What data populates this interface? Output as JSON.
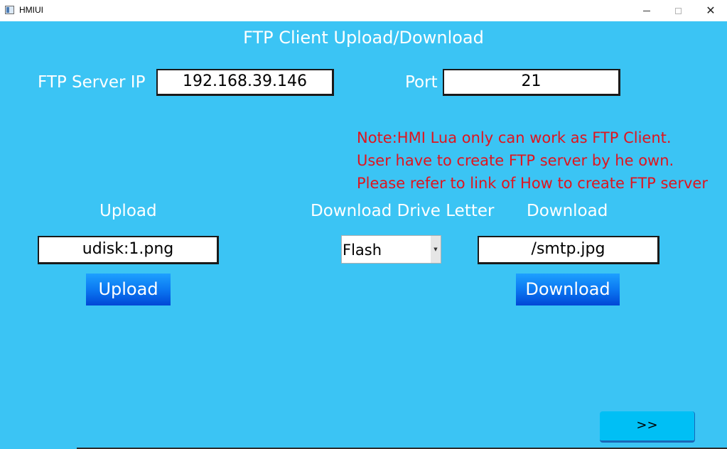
{
  "window": {
    "title": "HMIUI",
    "controls": {
      "minimize_icon": "minimize-icon",
      "maximize_icon": "maximize-icon",
      "close_icon": "close-icon"
    }
  },
  "screen": {
    "title": "FTP Client Upload/Download"
  },
  "server": {
    "ip_label": "FTP Server IP",
    "ip_value": "192.168.39.146",
    "port_label": "Port",
    "port_value": "21"
  },
  "note": {
    "line1": "Note:HMI Lua only can work as FTP Client.",
    "line2": "User have to create FTP server by he own.",
    "line3": "Please refer to link of How to create FTP server",
    "color": "#e0141e"
  },
  "upload": {
    "label": "Upload",
    "file_value": "udisk:1.png",
    "button_label": "Upload"
  },
  "download": {
    "drive_label": "Download Drive Letter",
    "drive_selected": "Flash",
    "label": "Download",
    "file_value": "/smtp.jpg",
    "button_label": "Download"
  },
  "navigation": {
    "next_label": ">>"
  },
  "colors": {
    "background": "#3bc4f4",
    "button_blue": "#0a74f0",
    "next_button": "#00bff5"
  }
}
